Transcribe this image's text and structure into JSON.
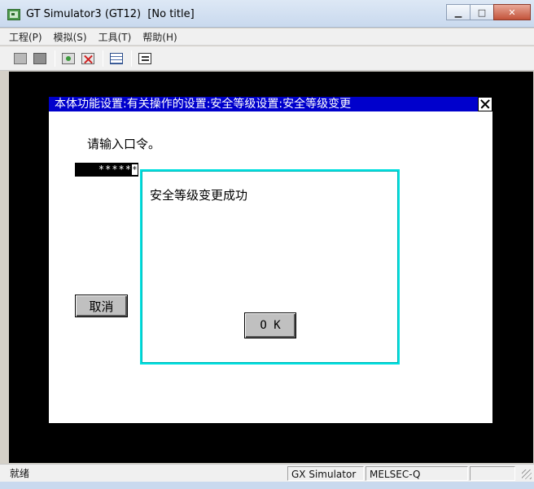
{
  "window": {
    "title": "GT Simulator3 (GT12)  [No title]",
    "minimize": "▁",
    "maximize": "□",
    "close": "✕"
  },
  "menu": [
    "工程(P)",
    "模拟(S)",
    "工具(T)",
    "帮助(H)"
  ],
  "toolbar_icons": [
    "open-project-icon",
    "save-project-icon",
    "start-simulation-icon",
    "stop-simulation-icon",
    "device-monitor-icon",
    "properties-icon"
  ],
  "panel": {
    "title": "本体功能设置:有关操作的设置:安全等级设置:安全等级变更",
    "prompt": "请输入口令。",
    "password_mask": "*****",
    "cursor": "*",
    "cancel_label": "取消"
  },
  "popup": {
    "message": "安全等级变更成功",
    "ok_label": "O K"
  },
  "status": {
    "left": "就绪",
    "simulator": "GX Simulator",
    "plc": "MELSEC-Q"
  },
  "colors": {
    "panel_title_bg": "#0000cc",
    "popup_border": "#00e0e0",
    "screen_bg": "#000000"
  }
}
